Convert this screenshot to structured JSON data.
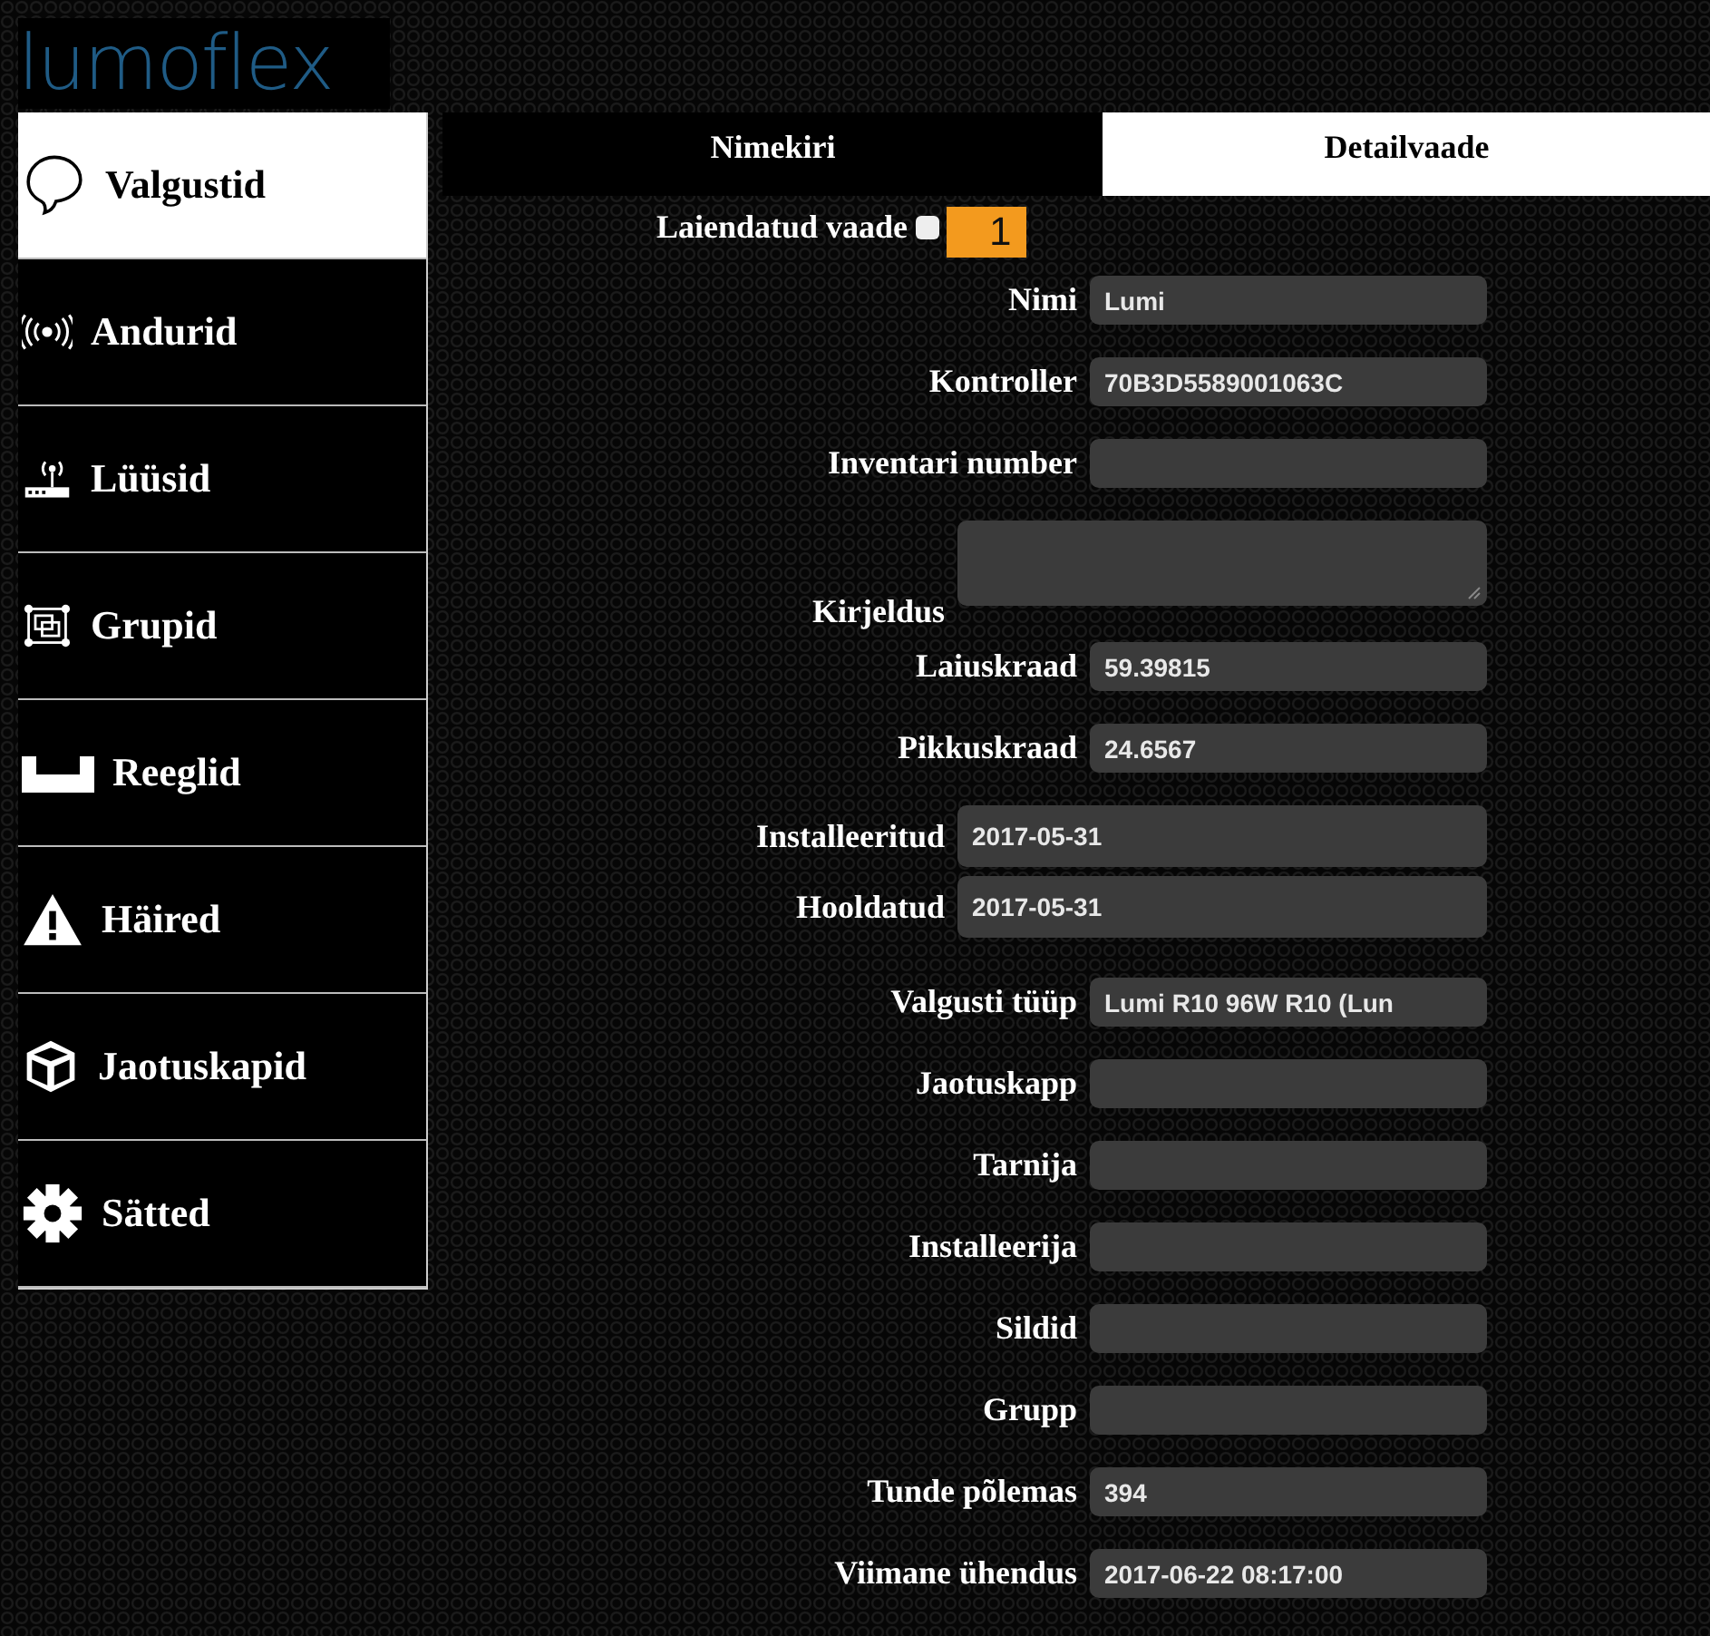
{
  "logo": "lumoflex",
  "sidebar": {
    "items": [
      {
        "label": "Valgustid",
        "selected": true
      },
      {
        "label": "Andurid",
        "selected": false
      },
      {
        "label": "Lüüsid",
        "selected": false
      },
      {
        "label": "Grupid",
        "selected": false
      },
      {
        "label": "Reeglid",
        "selected": false
      },
      {
        "label": "Häired",
        "selected": false
      },
      {
        "label": "Jaotuskapid",
        "selected": false
      },
      {
        "label": "Sätted",
        "selected": false
      }
    ]
  },
  "tabs": [
    {
      "label": "Nimekiri",
      "selected": false
    },
    {
      "label": "Detailvaade",
      "selected": true
    }
  ],
  "extended_view": {
    "label": "Laiendatud vaade",
    "checked": false,
    "badge": "1"
  },
  "fields": [
    {
      "kind": "text",
      "label": "Nimi",
      "value": "Lumi"
    },
    {
      "kind": "text",
      "label": "Kontroller",
      "value": "70B3D5589001063C"
    },
    {
      "kind": "text",
      "label": "Inventari number"
    },
    {
      "kind": "textarea",
      "label": "Kirjeldus"
    },
    {
      "kind": "text",
      "label": "Laiuskraad",
      "value": "59.39815"
    },
    {
      "kind": "text",
      "label": "Pikkuskraad",
      "value": "24.6567"
    },
    {
      "kind": "date",
      "label": "Installeeritud",
      "value": "2017-05-31"
    },
    {
      "kind": "date",
      "label": "Hooldatud",
      "value": "2017-05-31"
    },
    {
      "kind": "text",
      "label": "Valgusti tüüp",
      "value": "Lumi R10 96W R10 (Lun"
    },
    {
      "kind": "text",
      "label": "Jaotuskapp"
    },
    {
      "kind": "text",
      "label": "Tarnija"
    },
    {
      "kind": "text",
      "label": "Installeerija"
    },
    {
      "kind": "text",
      "label": "Sildid"
    },
    {
      "kind": "text",
      "label": "Grupp"
    },
    {
      "kind": "text",
      "label": "Tunde põlemas",
      "value": "394"
    },
    {
      "kind": "text",
      "label": "Viimane ühendus",
      "value": "2017-06-22 08:17:00"
    }
  ]
}
